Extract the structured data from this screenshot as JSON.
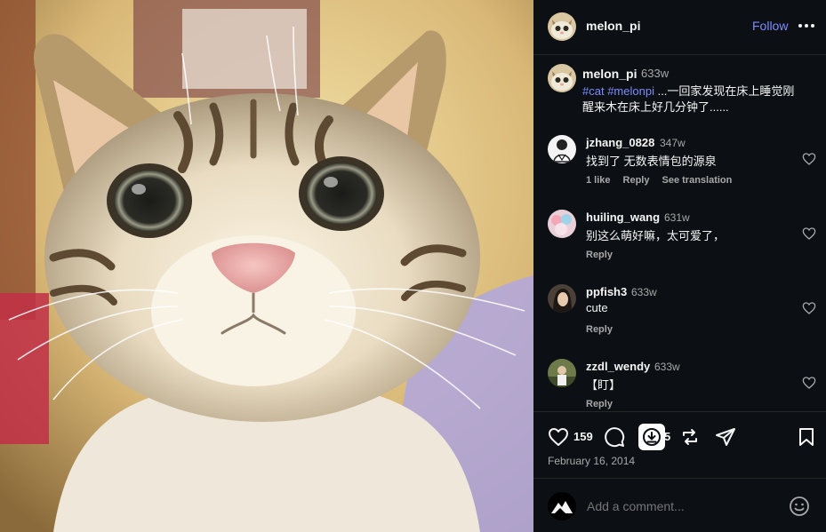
{
  "post": {
    "author": "melon_pi",
    "follow_label": "Follow",
    "more_icon": "more-horizontal-icon",
    "image_icon": "cat-photo"
  },
  "caption": {
    "user": "melon_pi",
    "time": "633w",
    "tag1": "#cat",
    "tag2": "#melonpi",
    "text": " ...一回家发现在床上睡觉刚醒来木在床上好几分钟了......"
  },
  "comments": [
    {
      "user": "jzhang_0828",
      "time": "347w",
      "text": "找到了 无数表情包的源泉",
      "likes": "1 like",
      "reply": "Reply",
      "translate": "See translation"
    },
    {
      "user": "huiling_wang",
      "time": "631w",
      "text": "别这么萌好嘛，太可爱了，",
      "reply": "Reply"
    },
    {
      "user": "ppfish3",
      "time": "633w",
      "text": "cute",
      "reply": "Reply"
    },
    {
      "user": "zzdl_wendy",
      "time": "633w",
      "text": "【盯】",
      "reply": "Reply"
    }
  ],
  "actions": {
    "like_count": "159",
    "comment_count": "5",
    "date": "February 16, 2014"
  },
  "add_comment": {
    "placeholder": "Add a comment..."
  },
  "colors": {
    "panel_bg": "#0c1014",
    "accent": "#7b8cff",
    "muted": "#a8a8a8"
  }
}
